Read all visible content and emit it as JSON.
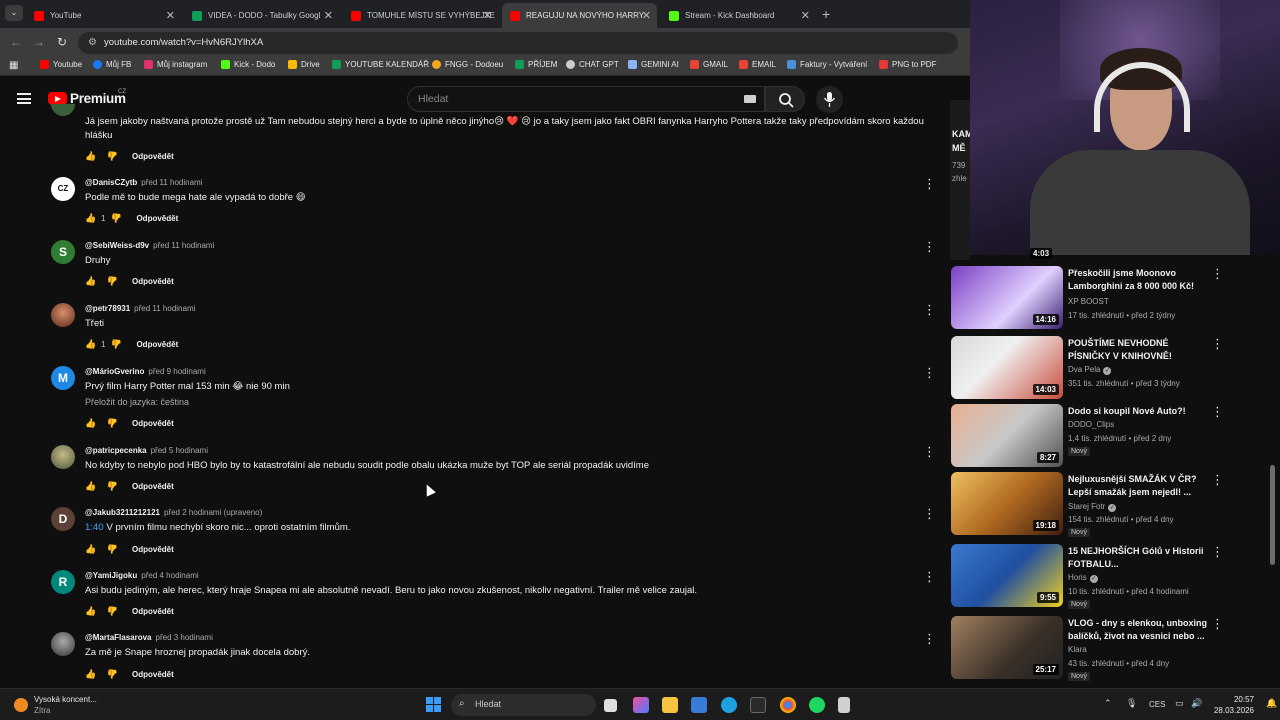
{
  "browser": {
    "tabs": [
      {
        "title": "YouTube",
        "color": "#ff0000",
        "active": false
      },
      {
        "title": "VIDEA - DODO - Tabulky Googl",
        "color": "#0f9d58",
        "active": false
      },
      {
        "title": "TOMUHLE MÍSTU SE VYHÝBEJTE",
        "color": "#ff0000",
        "active": false
      },
      {
        "title": "REAGUJU NA NOVÝHO HARRY",
        "color": "#ff0000",
        "active": true
      },
      {
        "title": "Stream - Kick Dashboard",
        "color": "#53fc18",
        "active": false
      }
    ],
    "url": "youtube.com/watch?v=HvN6RJYlhXA",
    "bookmarks": [
      {
        "label": "Youtube",
        "color": "#ff0000"
      },
      {
        "label": "Můj FB",
        "color": "#1877f2"
      },
      {
        "label": "Můj instagram",
        "color": "#e1306c"
      },
      {
        "label": "Kick - Dodo",
        "color": "#53fc18"
      },
      {
        "label": "Drive",
        "color": "#fbbc04"
      },
      {
        "label": "YOUTUBE KALENDÁŘ",
        "color": "#0f9d58"
      },
      {
        "label": "FNGG - Dodoeu",
        "color": "#f5a623"
      },
      {
        "label": "PŘÍJEM",
        "color": "#0f9d58"
      },
      {
        "label": "CHAT GPT",
        "color": "#cccccc"
      },
      {
        "label": "GEMINI AI",
        "color": "#8ab4f8"
      },
      {
        "label": "GMAIL",
        "color": "#ea4335"
      },
      {
        "label": "EMAIL",
        "color": "#ea4335"
      },
      {
        "label": "Faktury - Vytváření",
        "color": "#4a90d9"
      },
      {
        "label": "PNG to PDF",
        "color": "#e53935"
      }
    ]
  },
  "header": {
    "brand": "Premium",
    "region": "CZ",
    "search_placeholder": "Hledat"
  },
  "comments": [
    {
      "author": "",
      "time": "",
      "text": "Já jsem jakoby naštvaná protože  prostě už Tam nebudou stejný herci a byde to úplně něco jinýho😢 ❤️ 😢  jo a taky jsem jako fakt OBRI fanynka Harryho Pottera  takže taky předpovídám skoro každou hlášku",
      "likes": "",
      "reply": "Odpovědět",
      "avatar": "",
      "avatar_color": "#3a5f3a"
    },
    {
      "author": "@DanisCZytb",
      "time": "před 11 hodinami",
      "text": "Podle mě to bude mega hate ale vypadá to dobře 😄",
      "likes": "1",
      "reply": "Odpovědět",
      "avatar": "CZ",
      "avatar_color": "#ffffff"
    },
    {
      "author": "@SebiWeiss-d9v",
      "time": "před 11 hodinami",
      "text": "Druhy",
      "likes": "",
      "reply": "Odpovědět",
      "avatar": "S",
      "avatar_color": "#2e7d32"
    },
    {
      "author": "@petr78931",
      "time": "před 11 hodinami",
      "text": "Třeti",
      "likes": "1",
      "reply": "Odpovědět",
      "avatar": "",
      "avatar_color": "#8d3b2a"
    },
    {
      "author": "@MárioGverino",
      "time": "před 9 hodinami",
      "text": "Prvý film Harry Potter mal 153 min 😂 nie 90 min",
      "translate": "Přeložit do jazyka: čeština",
      "likes": "",
      "reply": "Odpovědět",
      "avatar": "M",
      "avatar_color": "#1e88e5"
    },
    {
      "author": "@patricpecenka",
      "time": "před 5 hodinami",
      "text": "No kdyby to nebylo pod HBO bylo by to katastrofální  ale nebudu soudit podle obalu ukázka muže byt TOP ale seriál propadák uvidíme",
      "likes": "",
      "reply": "Odpovědět",
      "avatar": "",
      "avatar_color": "#7a8a5a"
    },
    {
      "author": "@Jakub3211212121",
      "time": "před 2 hodinami (upraveno)",
      "timestamp": "1:40",
      "text": "V prvním filmu nechybí skoro nic... oproti ostatním filmům.",
      "likes": "",
      "reply": "Odpovědět",
      "avatar": "D",
      "avatar_color": "#5d4037"
    },
    {
      "author": "@YamiJigoku",
      "time": "před 4 hodinami",
      "text": "Asi budu jediným, ale herec, který hraje Snapea mi ale absolutně nevadí. Beru to jako novou zkušenost, nikoliv negativní. Trailer mě velice zaujal.",
      "likes": "",
      "reply": "Odpovědět",
      "avatar": "R",
      "avatar_color": "#00897b"
    },
    {
      "author": "@MartaFlasarova",
      "time": "před 3 hodinami",
      "text": "Za mě je Snape hroznej propadák jinak docela dobrý.",
      "likes": "",
      "reply": "Odpovědět",
      "avatar": "",
      "avatar_color": "#555555"
    }
  ],
  "sidebar_partial": {
    "title_line1": "KAM",
    "title_line2": "MĚ",
    "stat": "739",
    "stat2": "zhle",
    "duration": "4:03"
  },
  "videos": [
    {
      "title": "Přeskočili jsme Moonovo Lamborghini za 8 000 000 Kč!",
      "channel": "XP BOOST",
      "verified": false,
      "stats": "17 tis. zhlédnutí • před 2 týdny",
      "duration": "14:16",
      "new": "",
      "thumb_a": "#7b3fc4",
      "thumb_b": "#e0d0ff"
    },
    {
      "title": "POUŠTÍME NEVHODNÉ PÍSNIČKY V KNIHOVNĚ!",
      "channel": "Dva Pela",
      "verified": true,
      "stats": "351 tis. zhlédnutí • před 3 týdny",
      "duration": "14:03",
      "new": "",
      "thumb_a": "#d8d8d8",
      "thumb_b": "#c84b3a"
    },
    {
      "title": "Dodo si koupil Nové Auto?!",
      "channel": "DODO_Clips",
      "verified": false,
      "stats": "1,4 tis. zhlédnutí • před 2 dny",
      "duration": "8:27",
      "new": "Nový",
      "thumb_a": "#c8c8c8",
      "thumb_b": "#e8b090"
    },
    {
      "title": "Nejluxusnější SMAŽÁK V ČR? Lepší smažák jsem nejedl! ...",
      "channel": "Starej Fotr",
      "verified": true,
      "stats": "154 tis. zhlédnutí • před 4 dny",
      "duration": "19:18",
      "new": "Nový",
      "thumb_a": "#b06a20",
      "thumb_b": "#f0c060"
    },
    {
      "title": "15 NEJHORŠÍCH Gólů v Historii FOTBALU...",
      "channel": "Horis",
      "verified": true,
      "stats": "10 tis. zhlédnutí • před 4 hodinami",
      "duration": "9:55",
      "new": "Nový",
      "thumb_a": "#1f4fa0",
      "thumb_b": "#3a7ad0"
    },
    {
      "title": "VLOG - dny s elenkou, unboxing balíčků, život na vesnici nebo ...",
      "channel": "Klara",
      "verified": false,
      "stats": "43 tis. zhlédnutí • před 4 dny",
      "duration": "25:17",
      "new": "Nový",
      "thumb_a": "#3a3028",
      "thumb_b": "#a08060"
    }
  ],
  "taskbar": {
    "weather_title": "Vysoká koncent...",
    "weather_sub": "Zítra",
    "search_placeholder": "Hledat",
    "lang": "CES",
    "time": "20:57",
    "date": "28.03.2026"
  }
}
